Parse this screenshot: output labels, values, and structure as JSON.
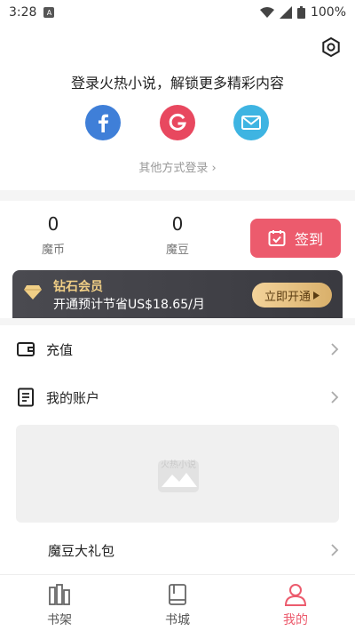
{
  "status_bar": {
    "time": "3:28",
    "battery": "100%"
  },
  "login": {
    "title": "登录火热小说，解锁更多精彩内容",
    "other_methods": "其他方式登录 ›",
    "providers": [
      "facebook-icon",
      "google-icon",
      "email-icon"
    ]
  },
  "wallet": {
    "coins_value": "0",
    "coins_label": "魔币",
    "beans_value": "0",
    "beans_label": "魔豆",
    "checkin_label": "签到"
  },
  "vip": {
    "title": "钻石会员",
    "desc": "开通预计节省US$18.65/月",
    "button": "立即开通"
  },
  "menu": {
    "recharge": "充值",
    "account": "我的账户",
    "banner_placeholder": "火热小说",
    "gift": "魔豆大礼包"
  },
  "tabs": [
    {
      "label": "书架"
    },
    {
      "label": "书城"
    },
    {
      "label": "我的"
    }
  ],
  "colors": {
    "accent": "#ec5b6d",
    "facebook": "#3f7fd8",
    "google": "#e8485f",
    "email": "#3eb4e2",
    "vip_gold": "#f1cf86"
  }
}
